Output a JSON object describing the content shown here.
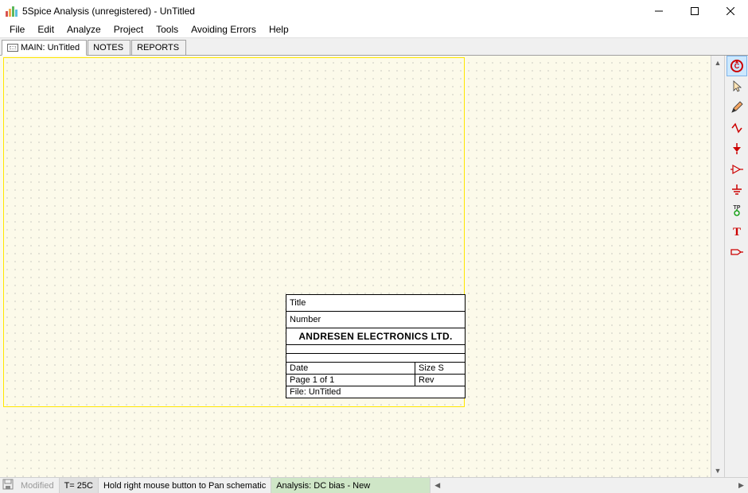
{
  "window": {
    "title": "5Spice Analysis (unregistered) - UnTitled"
  },
  "menu": {
    "items": [
      "File",
      "Edit",
      "Analyze",
      "Project",
      "Tools",
      "Avoiding Errors",
      "Help"
    ]
  },
  "tabs": [
    {
      "label": "MAIN: UnTitled",
      "active": true
    },
    {
      "label": "NOTES",
      "active": false
    },
    {
      "label": "REPORTS",
      "active": false
    }
  ],
  "titleblock": {
    "title_label": "Title",
    "number_label": "Number",
    "company": "ANDRESEN ELECTRONICS LTD.",
    "date_label": "Date",
    "size_label": "Size  S",
    "page_label": "Page   1            of   1",
    "rev_label": "Rev",
    "file_label": "File:  UnTitled"
  },
  "status": {
    "modified": "Modified",
    "temp": "T= 25C",
    "hint": "Hold right mouse button to Pan schematic",
    "analysis": "Analysis:  DC bias - New"
  },
  "tools": [
    {
      "name": "rebuild-circuit",
      "selected": true
    },
    {
      "name": "pointer",
      "selected": false
    },
    {
      "name": "pencil",
      "selected": false
    },
    {
      "name": "wire",
      "selected": false
    },
    {
      "name": "signal-source",
      "selected": false
    },
    {
      "name": "buffer",
      "selected": false
    },
    {
      "name": "ground",
      "selected": false
    },
    {
      "name": "test-point",
      "selected": false
    },
    {
      "name": "text",
      "selected": false
    },
    {
      "name": "port",
      "selected": false
    }
  ]
}
